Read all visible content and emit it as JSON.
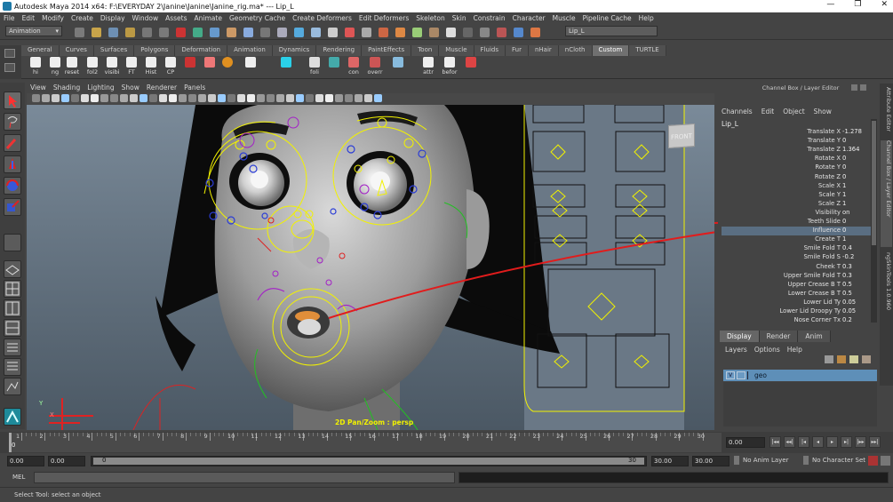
{
  "window": {
    "title": "Autodesk Maya 2014 x64: F:\\EVERYDAY 2\\Janine\\Janine\\Janine_rig.ma*   ---   Lip_L",
    "controls": [
      "—",
      "❐",
      "✕"
    ]
  },
  "menubar": [
    "File",
    "Edit",
    "Modify",
    "Create",
    "Display",
    "Window",
    "Assets",
    "Animate",
    "Geometry Cache",
    "Create Deformers",
    "Edit Deformers",
    "Skeleton",
    "Skin",
    "Constrain",
    "Character",
    "Muscle",
    "Pipeline Cache",
    "Help"
  ],
  "statusline": {
    "menuset": "Animation",
    "name_field": "Lip_L"
  },
  "shelf_tabs": [
    "General",
    "Curves",
    "Surfaces",
    "Polygons",
    "Deformation",
    "Animation",
    "Dynamics",
    "Rendering",
    "PaintEffects",
    "Toon",
    "Muscle",
    "Fluids",
    "Fur",
    "nHair",
    "nCloth",
    "Custom",
    "TURTLE"
  ],
  "shelf_active": "Custom",
  "shelf_buttons": [
    "hi",
    "ng",
    "reset",
    "fol2",
    "visibi",
    "FT",
    "Hist",
    "CP",
    "",
    "",
    "",
    "",
    "",
    "foli",
    "",
    "con",
    "overr",
    "",
    "attr",
    "befor",
    ""
  ],
  "panel_menu": [
    "View",
    "Shading",
    "Lighting",
    "Show",
    "Renderer",
    "Panels"
  ],
  "viewport": {
    "cube_label": "FRONT",
    "hud_label": "2D Pan/Zoom : persp",
    "axis_y": "Y",
    "axis_x": "X",
    "colors": {
      "arrow": "#e11c1c",
      "ctrl_yellow": "#f2f200",
      "ctrl_purple": "#a31fc7",
      "ctrl_blue": "#2b3dd6"
    }
  },
  "channel_box": {
    "title": "Channel Box / Layer Editor",
    "menu": [
      "Channels",
      "Edit",
      "Object",
      "Show"
    ],
    "object": "Lip_L",
    "attributes": [
      {
        "name": "Translate X",
        "value": "-1.278"
      },
      {
        "name": "Translate Y",
        "value": "0"
      },
      {
        "name": "Translate Z",
        "value": "1.364"
      },
      {
        "name": "Rotate X",
        "value": "0"
      },
      {
        "name": "Rotate Y",
        "value": "0"
      },
      {
        "name": "Rotate Z",
        "value": "0"
      },
      {
        "name": "Scale X",
        "value": "1"
      },
      {
        "name": "Scale Y",
        "value": "1"
      },
      {
        "name": "Scale Z",
        "value": "1"
      },
      {
        "name": "Visibility",
        "value": "on"
      },
      {
        "name": "Teeth Slide",
        "value": "0"
      },
      {
        "name": "Influence",
        "value": "0"
      },
      {
        "name": "Create T",
        "value": "1"
      },
      {
        "name": "Smile Fold T",
        "value": "0.4"
      },
      {
        "name": "Smile Fold S",
        "value": "-0.2"
      },
      {
        "name": "Cheek T",
        "value": "0.3"
      },
      {
        "name": "Upper Smile Fold T",
        "value": "0.3"
      },
      {
        "name": "Upper Crease B T",
        "value": "0.5"
      },
      {
        "name": "Lower Crease B T",
        "value": "0.5"
      },
      {
        "name": "Lower Lid Ty",
        "value": "0.05"
      },
      {
        "name": "Lower Lid Droopy Ty",
        "value": "0.05"
      },
      {
        "name": "Nose Corner Tx",
        "value": "0.2"
      }
    ]
  },
  "side_tabs": [
    "Attribute Editor",
    "Channel Box / Layer Editor",
    "ngSkinTools 1.0.960"
  ],
  "layer_editor": {
    "tabs": [
      "Display",
      "Render",
      "Anim"
    ],
    "active_tab": "Display",
    "menu": [
      "Layers",
      "Options",
      "Help"
    ],
    "layer": {
      "visible": "V",
      "name": "geo"
    }
  },
  "timeline": {
    "ticks": [
      "1",
      "2",
      "3",
      "4",
      "5",
      "6",
      "7",
      "8",
      "9",
      "10",
      "11",
      "12",
      "13",
      "14",
      "15",
      "16",
      "17",
      "18",
      "19",
      "20",
      "21",
      "22",
      "23",
      "24",
      "25",
      "26",
      "27",
      "28",
      "29",
      "30"
    ],
    "start_label": "0",
    "current_frame": "0.00"
  },
  "range": {
    "start": "0.00",
    "inner_start": "0.00",
    "slider_start": "0",
    "slider_end": "30",
    "end": "30.00",
    "anim_end": "30.00",
    "anim_layer": "No Anim Layer",
    "char_set": "No Character Set"
  },
  "mel": {
    "label": "MEL"
  },
  "help_line": "Select Tool: select an object"
}
